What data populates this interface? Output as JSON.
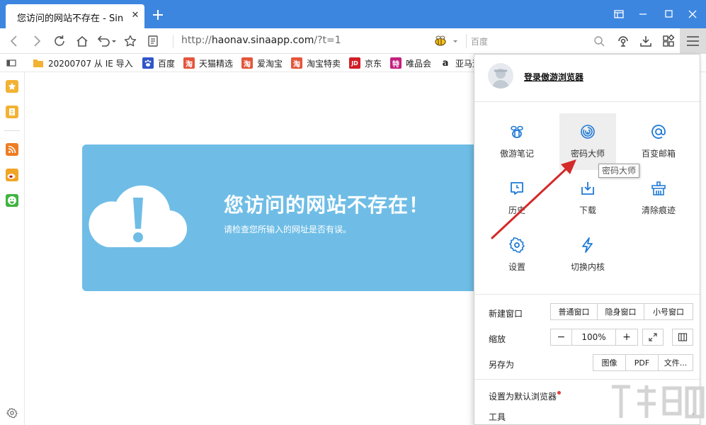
{
  "tab": {
    "title": "您访问的网站不存在 - Sina App",
    "close": "✕"
  },
  "toolbar": {
    "url_protocol": "http://",
    "url_host": "haonav.sinaapp.com",
    "url_path": "/?t=1",
    "search_placeholder": "百度"
  },
  "bookmarks": [
    {
      "label": "20200707 从 IE 导入",
      "icon": "folder-icon",
      "color": "#f2b233"
    },
    {
      "label": "百度",
      "icon": "baidu-icon",
      "color": "#2f55c8"
    },
    {
      "label": "天猫精选",
      "icon": "tao-icon",
      "color": "#e4553c",
      "glyph": "淘"
    },
    {
      "label": "爱淘宝",
      "icon": "tao-icon",
      "color": "#e4553c",
      "glyph": "淘"
    },
    {
      "label": "淘宝特卖",
      "icon": "tao-icon",
      "color": "#e4553c",
      "glyph": "淘"
    },
    {
      "label": "京东",
      "icon": "jd-icon",
      "color": "#d21e25",
      "glyph": "JD"
    },
    {
      "label": "唯品会",
      "icon": "vip-icon",
      "color": "#c2207f",
      "glyph": "特"
    },
    {
      "label": "亚马逊",
      "icon": "amazon-icon",
      "color": "#222222",
      "glyph": "a"
    }
  ],
  "error": {
    "title": "您访问的网站不存在！",
    "subtitle": "请检查您所输入的网址是否有误。"
  },
  "menu": {
    "login": "登录傲游浏览器",
    "grid": [
      {
        "label": "傲游笔记",
        "icon": "bee-icon"
      },
      {
        "label": "密码大师",
        "icon": "fingerprint-icon"
      },
      {
        "label": "百变邮箱",
        "icon": "mail-icon"
      },
      {
        "label": "历史",
        "icon": "history-icon"
      },
      {
        "label": "下载",
        "icon": "download-icon"
      },
      {
        "label": "清除痕迹",
        "icon": "clean-icon"
      },
      {
        "label": "设置",
        "icon": "settings-icon"
      },
      {
        "label": "切换内核",
        "icon": "bolt-icon"
      }
    ],
    "new_window": {
      "label": "新建窗口",
      "options": [
        "普通窗口",
        "隐身窗口",
        "小号窗口"
      ]
    },
    "zoom": {
      "label": "缩放",
      "minus": "−",
      "value": "100%",
      "plus": "+"
    },
    "save_as": {
      "label": "另存为",
      "options": [
        "图像",
        "PDF",
        "文件..."
      ]
    },
    "set_default": "设置为默认浏览器",
    "tools": "工具"
  },
  "tooltip": "密码大师",
  "colors": {
    "accent": "#3d86e0",
    "icon_blue": "#1f7ad6",
    "error_card": "#6fbde6",
    "arrow": "#d42a2a"
  }
}
